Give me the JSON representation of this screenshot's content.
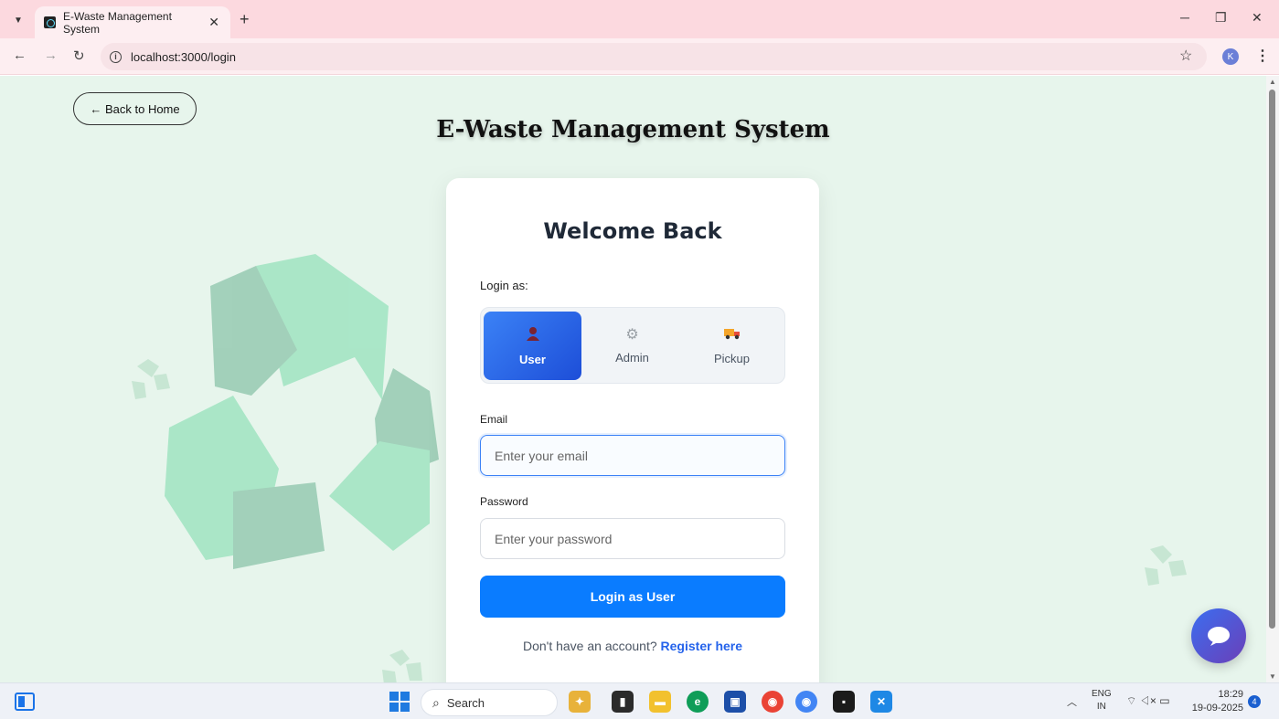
{
  "browser": {
    "tab_title": "E-Waste Management System",
    "tab_close": "✕",
    "new_tab": "+",
    "url": "localhost:3000/login",
    "profile_initial": "K"
  },
  "page": {
    "back_label": "← Back to Home",
    "site_title": "E-Waste Management System",
    "card_title": "Welcome Back",
    "login_as_label": "Login as:",
    "roles": [
      {
        "label": "User",
        "icon": "user-icon",
        "active": true
      },
      {
        "label": "Admin",
        "icon": "gear-icon",
        "active": false
      },
      {
        "label": "Pickup",
        "icon": "truck-icon",
        "active": false
      }
    ],
    "email_label": "Email",
    "email_placeholder": "Enter your email",
    "password_label": "Password",
    "password_placeholder": "Enter your password",
    "submit_label": "Login as User",
    "register_prompt": "Don't have an account?",
    "register_link": "Register here"
  },
  "taskbar": {
    "search_label": "Search",
    "lang_top": "ENG",
    "lang_bottom": "IN",
    "time": "18:29",
    "date": "19-09-2025",
    "notification_count": "4"
  },
  "colors": {
    "accent": "#0a7cff",
    "active_role": "#2563eb",
    "background": "#e7f5ec",
    "tabbar": "#fcd9df"
  }
}
